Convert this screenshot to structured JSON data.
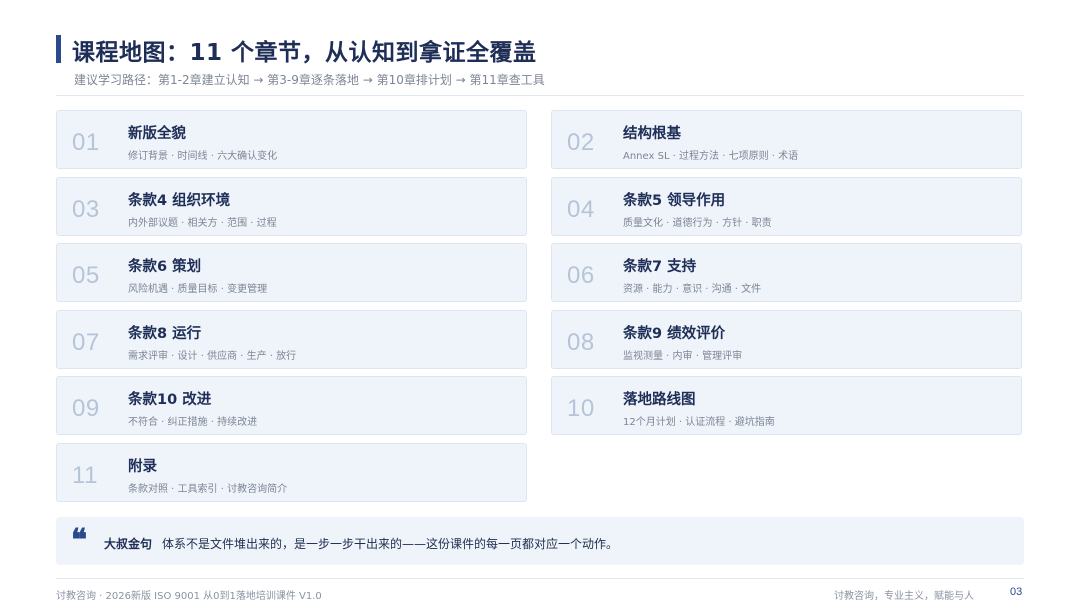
{
  "header": {
    "title": "课程地图：11 个章节，从认知到拿证全覆盖",
    "subtitle": "建议学习路径：第1-2章建立认知 → 第3-9章逐条落地 → 第10章排计划 → 第11章查工具"
  },
  "chapters": [
    {
      "num": "01",
      "title": "新版全貌",
      "desc": "修订背景 · 时间线 · 六大确认变化"
    },
    {
      "num": "02",
      "title": "结构根基",
      "desc": "Annex SL · 过程方法 · 七项原则 · 术语"
    },
    {
      "num": "03",
      "title": "条款4 组织环境",
      "desc": "内外部议题 · 相关方 · 范围 · 过程"
    },
    {
      "num": "04",
      "title": "条款5 领导作用",
      "desc": "质量文化 · 道德行为 · 方针 · 职责"
    },
    {
      "num": "05",
      "title": "条款6 策划",
      "desc": "风险机遇 · 质量目标 · 变更管理"
    },
    {
      "num": "06",
      "title": "条款7 支持",
      "desc": "资源 · 能力 · 意识 · 沟通 · 文件"
    },
    {
      "num": "07",
      "title": "条款8 运行",
      "desc": "需求评审 · 设计 · 供应商 · 生产 · 放行"
    },
    {
      "num": "08",
      "title": "条款9 绩效评价",
      "desc": "监视测量 · 内审 · 管理评审"
    },
    {
      "num": "09",
      "title": "条款10 改进",
      "desc": "不符合 · 纠正措施 · 持续改进"
    },
    {
      "num": "10",
      "title": "落地路线图",
      "desc": "12个月计划 · 认证流程 · 避坑指南"
    },
    {
      "num": "11",
      "title": "附录",
      "desc": "条款对照 · 工具索引 · 讨教咨询简介"
    }
  ],
  "quote": {
    "icon": "❝",
    "label": "大叔金句",
    "text": "体系不是文件堆出来的，是一步一步干出来的——这份课件的每一页都对应一个动作。"
  },
  "footer": {
    "left": "讨教咨询 · 2026新版 ISO 9001 从0到1落地培训课件 V1.0",
    "right": "讨教咨询，专业主义，赋能与人",
    "page": "03"
  },
  "colors": {
    "accent": "#2b4a8b",
    "card_bg": "#eff4fa",
    "number": "#b6c4d8"
  }
}
